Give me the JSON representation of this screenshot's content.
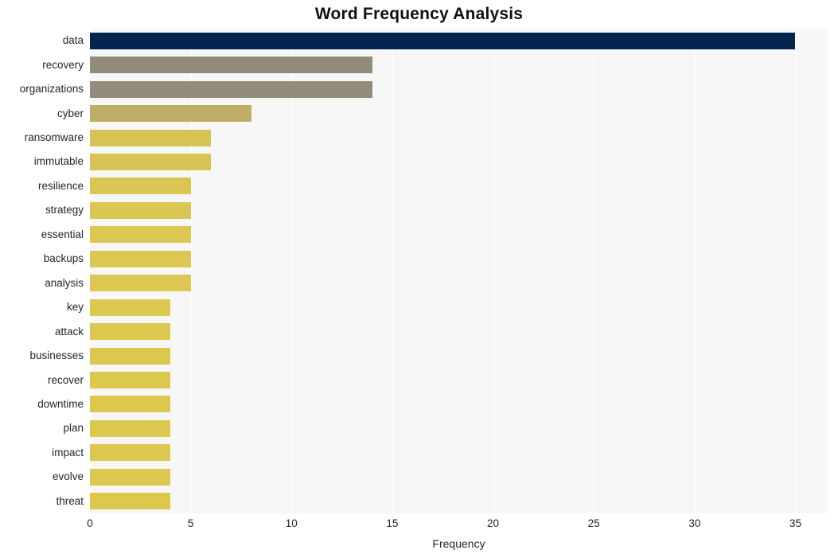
{
  "chart_data": {
    "type": "bar",
    "orientation": "horizontal",
    "title": "Word Frequency Analysis",
    "xlabel": "Frequency",
    "ylabel": "",
    "xlim": [
      0,
      36.6
    ],
    "xticks": [
      0,
      5,
      10,
      15,
      20,
      25,
      30,
      35
    ],
    "xtick_labels": [
      "0",
      "5",
      "10",
      "15",
      "20",
      "25",
      "30",
      "35"
    ],
    "grid": "vertical-white-on-gray",
    "legend": "none",
    "categories": [
      "data",
      "recovery",
      "organizations",
      "cyber",
      "ransomware",
      "immutable",
      "resilience",
      "strategy",
      "essential",
      "backups",
      "analysis",
      "key",
      "attack",
      "businesses",
      "recover",
      "downtime",
      "plan",
      "impact",
      "evolve",
      "threat"
    ],
    "values": [
      35,
      14,
      14,
      8,
      6,
      6,
      5,
      5,
      5,
      5,
      5,
      4,
      4,
      4,
      4,
      4,
      4,
      4,
      4,
      4
    ],
    "bar_colors": [
      "#04244f",
      "#908c79",
      "#918d7a",
      "#bfae68",
      "#d6c356",
      "#d7c455",
      "#dac653",
      "#dac653",
      "#dbc751",
      "#dbc751",
      "#dbc751",
      "#dcc74f",
      "#dcc74f",
      "#dcc74f",
      "#dcc74f",
      "#dcc74f",
      "#dcc74f",
      "#dcc74f",
      "#dcc74f",
      "#dcc74f"
    ]
  },
  "style": {
    "figure_background": "#ffffff",
    "plot_background": "#f7f7f7",
    "gridline_color": "#ffffff",
    "text_color": "#262626",
    "title_color": "#111111"
  }
}
